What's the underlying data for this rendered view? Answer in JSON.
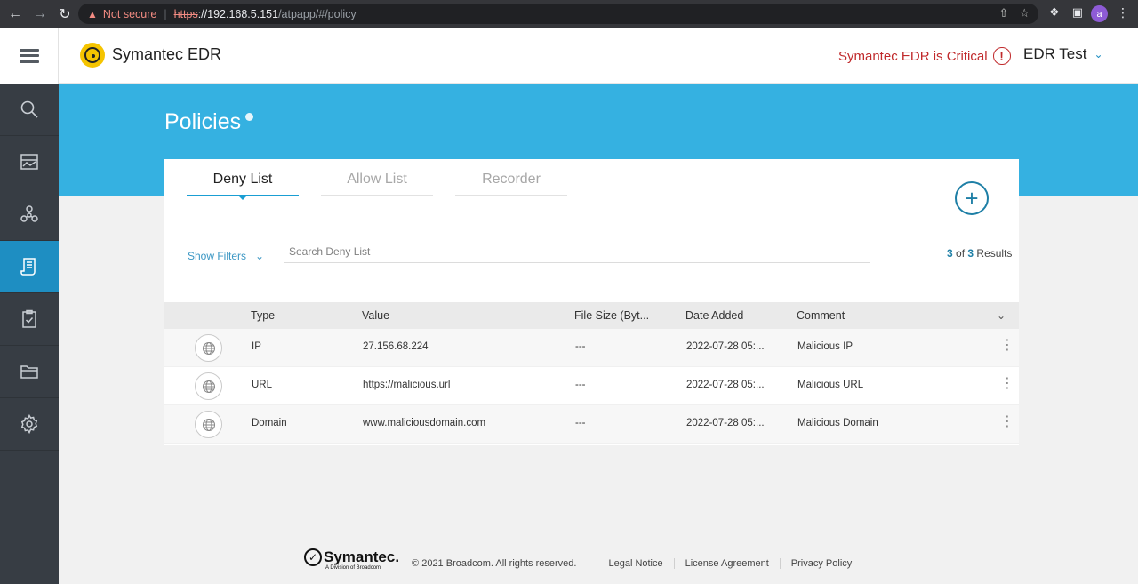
{
  "browser": {
    "warning": "Not secure",
    "url_proto": "https",
    "url_host": "://192.168.5.151",
    "url_path": "/atpapp/#/policy",
    "avatar_letter": "a"
  },
  "header": {
    "brand": "Symantec EDR",
    "status": "Symantec EDR is Critical",
    "status_icon": "!",
    "user": "EDR Test"
  },
  "sidebar": {
    "items": [
      {
        "name": "search",
        "icon": "search-icon",
        "active": false
      },
      {
        "name": "dashboard",
        "icon": "dashboard-icon",
        "active": false
      },
      {
        "name": "entities",
        "icon": "network-icon",
        "active": false
      },
      {
        "name": "policies",
        "icon": "policy-icon",
        "active": true
      },
      {
        "name": "tasks",
        "icon": "clipboard-icon",
        "active": false
      },
      {
        "name": "files",
        "icon": "folder-icon",
        "active": false
      },
      {
        "name": "settings",
        "icon": "gear-icon",
        "active": false
      }
    ]
  },
  "page": {
    "title": "Policies"
  },
  "tabs": [
    "Deny List",
    "Allow List",
    "Recorder"
  ],
  "filters": {
    "label": "Show Filters",
    "search_placeholder": "Search Deny List"
  },
  "results": {
    "shown": "3",
    "of": "of",
    "total": "3",
    "label": "Results"
  },
  "table": {
    "columns": [
      "Type",
      "Value",
      "File Size (Byt...",
      "Date Added",
      "Comment"
    ],
    "rows": [
      {
        "type": "IP",
        "value": "27.156.68.224",
        "size": "---",
        "date": "2022-07-28 05:...",
        "comment": "Malicious IP"
      },
      {
        "type": "URL",
        "value": "https://malicious.url",
        "size": "---",
        "date": "2022-07-28 05:...",
        "comment": "Malicious URL"
      },
      {
        "type": "Domain",
        "value": "www.maliciousdomain.com",
        "size": "---",
        "date": "2022-07-28 05:...",
        "comment": "Malicious Domain"
      }
    ]
  },
  "footer": {
    "logo_name": "Symantec.",
    "logo_sub": "A Division of Broadcom",
    "copyright": "© 2021 Broadcom. All rights reserved.",
    "links": [
      "Legal Notice",
      "License Agreement",
      "Privacy Policy"
    ]
  },
  "colors": {
    "accent": "#35b1e1",
    "sidebar": "#373d44",
    "active": "#1e8ec2",
    "critical": "#c0292b"
  }
}
